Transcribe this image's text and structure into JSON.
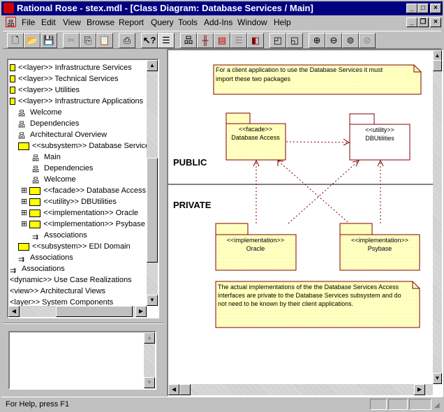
{
  "window": {
    "title": "Rational Rose - stex.mdl - [Class Diagram: Database Services / Main]"
  },
  "menu": [
    "File",
    "Edit",
    "View",
    "Browse",
    "Report",
    "Query",
    "Tools",
    "Add-Ins",
    "Window",
    "Help"
  ],
  "toolbar": [
    "new",
    "open",
    "save",
    "cut",
    "copy",
    "paste",
    "print",
    "context-help",
    "view-doc",
    "browse-class-diagram",
    "browse-interaction-diagram",
    "browse-component-diagram",
    "browse-state-diagram",
    "browse-deployment-diagram",
    "previous-diagram",
    "browse-parent",
    "zoom-in",
    "zoom-out",
    "fit-in-window",
    "undo-fit"
  ],
  "tree": [
    {
      "label": "<<layer>> Infrastructure Services",
      "icon": "layer"
    },
    {
      "label": "<<layer>> Technical Services",
      "icon": "layer"
    },
    {
      "label": "<<layer>> Utilities",
      "icon": "layer"
    },
    {
      "label": "<<layer>> Infrastructure Applications",
      "icon": "layer"
    },
    {
      "label": "Welcome",
      "icon": "diagram"
    },
    {
      "label": "Dependencies",
      "icon": "diagram"
    },
    {
      "label": "Architectural Overview",
      "icon": "diagram"
    },
    {
      "label": "<<subsystem>> Database Services",
      "icon": "folder"
    },
    {
      "label": "Main",
      "icon": "diagram"
    },
    {
      "label": "Dependencies",
      "icon": "diagram"
    },
    {
      "label": "Welcome",
      "icon": "diagram"
    },
    {
      "label": "<<facade>> Database Access",
      "icon": "folder"
    },
    {
      "label": "<<utility>> DBUtilities",
      "icon": "folder"
    },
    {
      "label": "<<implementation>> Oracle",
      "icon": "folder"
    },
    {
      "label": "<<implementation>> Psybase",
      "icon": "folder"
    },
    {
      "label": "Associations",
      "icon": "associations"
    },
    {
      "label": "<<subsystem>> EDI Domain",
      "icon": "folder"
    },
    {
      "label": "Associations",
      "icon": "associations"
    },
    {
      "label": "Associations",
      "icon": "associations"
    },
    {
      "label": "<dynamic>> Use Case Realizations",
      "icon": "none"
    },
    {
      "label": "<view>> Architectural Views",
      "icon": "none"
    },
    {
      "label": "<layer>> System Components",
      "icon": "none"
    }
  ],
  "diagram": {
    "note_public": [
      "For a client application to use the Database Services it must",
      "import these two packages"
    ],
    "public_label": "PUBLIC",
    "private_label": "PRIVATE",
    "packages": [
      {
        "stereotype": "<<facade>>",
        "name": "Database Access"
      },
      {
        "stereotype": "<<utility>>",
        "name": "DBUtilities"
      },
      {
        "stereotype": "<<implementation>>",
        "name": "Oracle"
      },
      {
        "stereotype": "<<implementation>>",
        "name": "Psybase"
      }
    ],
    "note_private": [
      "The actual implementations of the the Database Services Access",
      "interfaces are private to the Database Services subsystem and do",
      "not need to be known by their client applications."
    ],
    "colors": {
      "line": "#800000",
      "fill": "#ffff99"
    }
  },
  "status": {
    "text": "For Help, press F1"
  }
}
